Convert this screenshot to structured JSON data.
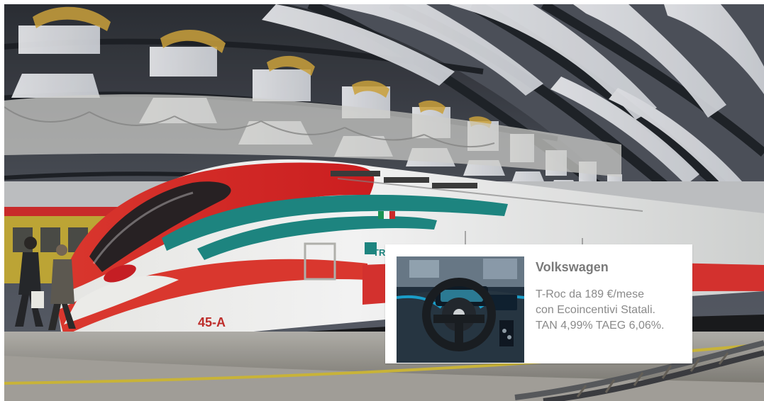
{
  "photo": {
    "train_logo_text": "TRENI",
    "train_number": "45-A"
  },
  "ad": {
    "brand": "Volkswagen",
    "body": "T-Roc da 189 €/mese\ncon Ecoincentivi Statali.\nTAN 4,99% TAEG 6,06%."
  },
  "colors": {
    "train_red": "#e53a31",
    "train_white": "#f3f1ee",
    "train_green": "#1f8c86",
    "ad_title": "#7a7a7a",
    "ad_body": "#8a8a8a"
  },
  "icons": {
    "train_brand": "trenitalia-logo-icon",
    "flag": "italy-flag-icon",
    "steering": "steering-wheel-icon"
  }
}
